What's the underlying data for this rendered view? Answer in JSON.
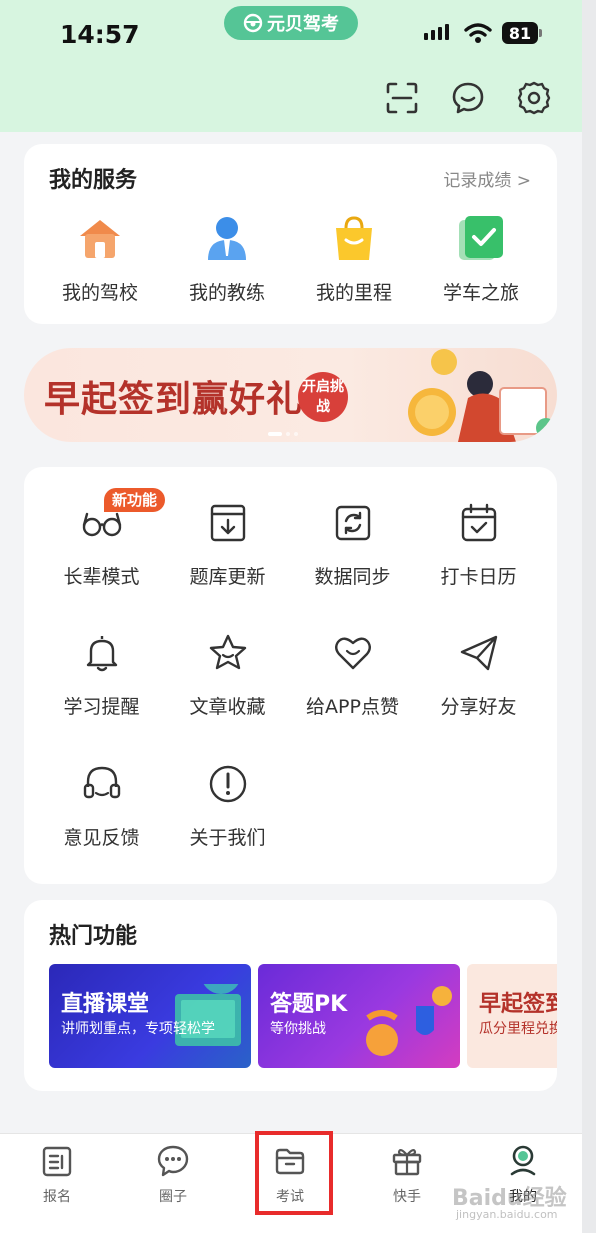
{
  "status_bar": {
    "time": "14:57",
    "battery": "81"
  },
  "app_pill": {
    "label": "元贝驾考"
  },
  "header_icons": [
    "scan-icon",
    "message-icon",
    "settings-icon"
  ],
  "services": {
    "title": "我的服务",
    "link": "记录成绩 >",
    "items": [
      {
        "label": "我的驾校",
        "icon": "school-house-icon"
      },
      {
        "label": "我的教练",
        "icon": "coach-icon"
      },
      {
        "label": "我的里程",
        "icon": "shopping-bag-icon"
      },
      {
        "label": "学车之旅",
        "icon": "checkmark-card-icon"
      }
    ]
  },
  "banner": {
    "title": "早起签到赢好礼",
    "button": "开启挑战"
  },
  "tools": {
    "badge": "新功能",
    "items": [
      {
        "label": "长辈模式",
        "icon": "glasses-icon"
      },
      {
        "label": "题库更新",
        "icon": "download-box-icon"
      },
      {
        "label": "数据同步",
        "icon": "sync-icon"
      },
      {
        "label": "打卡日历",
        "icon": "calendar-check-icon"
      },
      {
        "label": "学习提醒",
        "icon": "bell-icon"
      },
      {
        "label": "文章收藏",
        "icon": "star-icon"
      },
      {
        "label": "给APP点赞",
        "icon": "heart-icon"
      },
      {
        "label": "分享好友",
        "icon": "paper-plane-icon"
      },
      {
        "label": "意见反馈",
        "icon": "headset-icon"
      },
      {
        "label": "关于我们",
        "icon": "info-circle-icon"
      }
    ]
  },
  "hot": {
    "title": "热门功能",
    "cards": [
      {
        "title": "直播课堂",
        "subtitle": "讲师划重点，专项轻松学"
      },
      {
        "title": "答题PK",
        "subtitle": "等你挑战"
      },
      {
        "title": "早起签到",
        "subtitle": "瓜分里程兑换"
      }
    ]
  },
  "tabbar": {
    "items": [
      {
        "label": "报名",
        "icon": "document-icon"
      },
      {
        "label": "圈子",
        "icon": "chat-bubble-icon"
      },
      {
        "label": "考试",
        "icon": "folder-icon"
      },
      {
        "label": "快手",
        "icon": "gift-icon"
      },
      {
        "label": "我的",
        "icon": "profile-icon"
      }
    ]
  },
  "watermark": {
    "text": "Baidu经验",
    "url": "jingyan.baidu.com"
  },
  "colors": {
    "accent_green": "#55c596",
    "header_bg": "#d7f5e0",
    "highlight_red": "#e82b2b",
    "badge_orange": "#ec5a2b"
  }
}
